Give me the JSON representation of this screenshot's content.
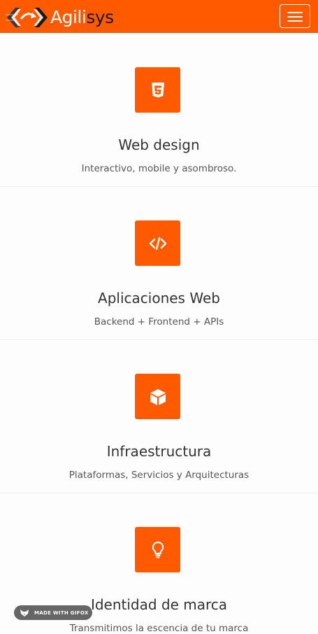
{
  "header": {
    "brand_part1": "Agili",
    "brand_part2": "sys",
    "brand_color": "#ff5a00",
    "menu_icon": "hamburger-menu-icon"
  },
  "services": [
    {
      "icon": "html5-icon",
      "title": "Web design",
      "description": "Interactivo, mobile y asombroso."
    },
    {
      "icon": "code-icon",
      "title": "Aplicaciones Web",
      "description": "Backend + Frontend + APIs"
    },
    {
      "icon": "cube-icon",
      "title": "Infraestructura",
      "description": "Plataformas, Servicios y Arquitecturas"
    },
    {
      "icon": "lightbulb-icon",
      "title": "Identidad de marca",
      "description": "Transmitimos la escencia de tu marca"
    }
  ],
  "badge": {
    "label": "MADE WITH GIFOX",
    "icon": "fox-icon"
  },
  "colors": {
    "accent": "#ff5a00",
    "text": "#333333",
    "muted": "#555555"
  }
}
